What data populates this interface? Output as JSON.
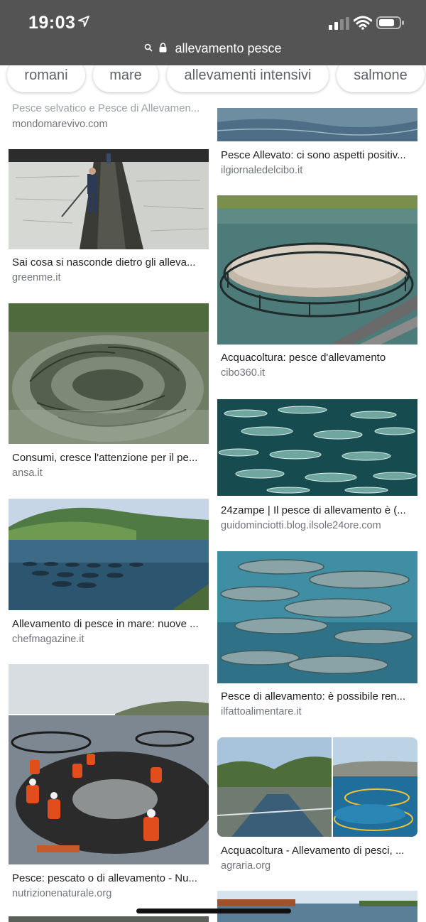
{
  "status": {
    "time": "19:03"
  },
  "url": {
    "text": "allevamento pesce"
  },
  "chips": [
    {
      "label": "romani"
    },
    {
      "label": "mare"
    },
    {
      "label": "allevamenti intensivi"
    },
    {
      "label": "salmone"
    }
  ],
  "left_results": [
    {
      "title": "Pesce selvatico e Pesce di Allevamen...",
      "source": "mondomarevivo.com"
    },
    {
      "title": "Sai cosa si nasconde dietro gli alleva...",
      "source": "greenme.it"
    },
    {
      "title": "Consumi, cresce l'attenzione per il pe...",
      "source": "ansa.it"
    },
    {
      "title": "Allevamento di pesce in mare: nuove ...",
      "source": "chefmagazine.it"
    },
    {
      "title": "Pesce: pescato o di allevamento - Nu...",
      "source": "nutrizionenaturale.org"
    }
  ],
  "right_results": [
    {
      "title": "Pesce Allevato: ci sono aspetti positiv...",
      "source": "ilgiornaledelcibo.it"
    },
    {
      "title": "Acquacoltura: pesce d'allevamento",
      "source": "cibo360.it"
    },
    {
      "title": "24zampe | Il pesce di allevamento è (...",
      "source": "guidominciotti.blog.ilsole24ore.com"
    },
    {
      "title": "Pesce di allevamento: è possibile ren...",
      "source": "ilfattoalimentare.it"
    },
    {
      "title": "Acquacoltura - Allevamento di pesci, ...",
      "source": "agraria.org"
    }
  ]
}
